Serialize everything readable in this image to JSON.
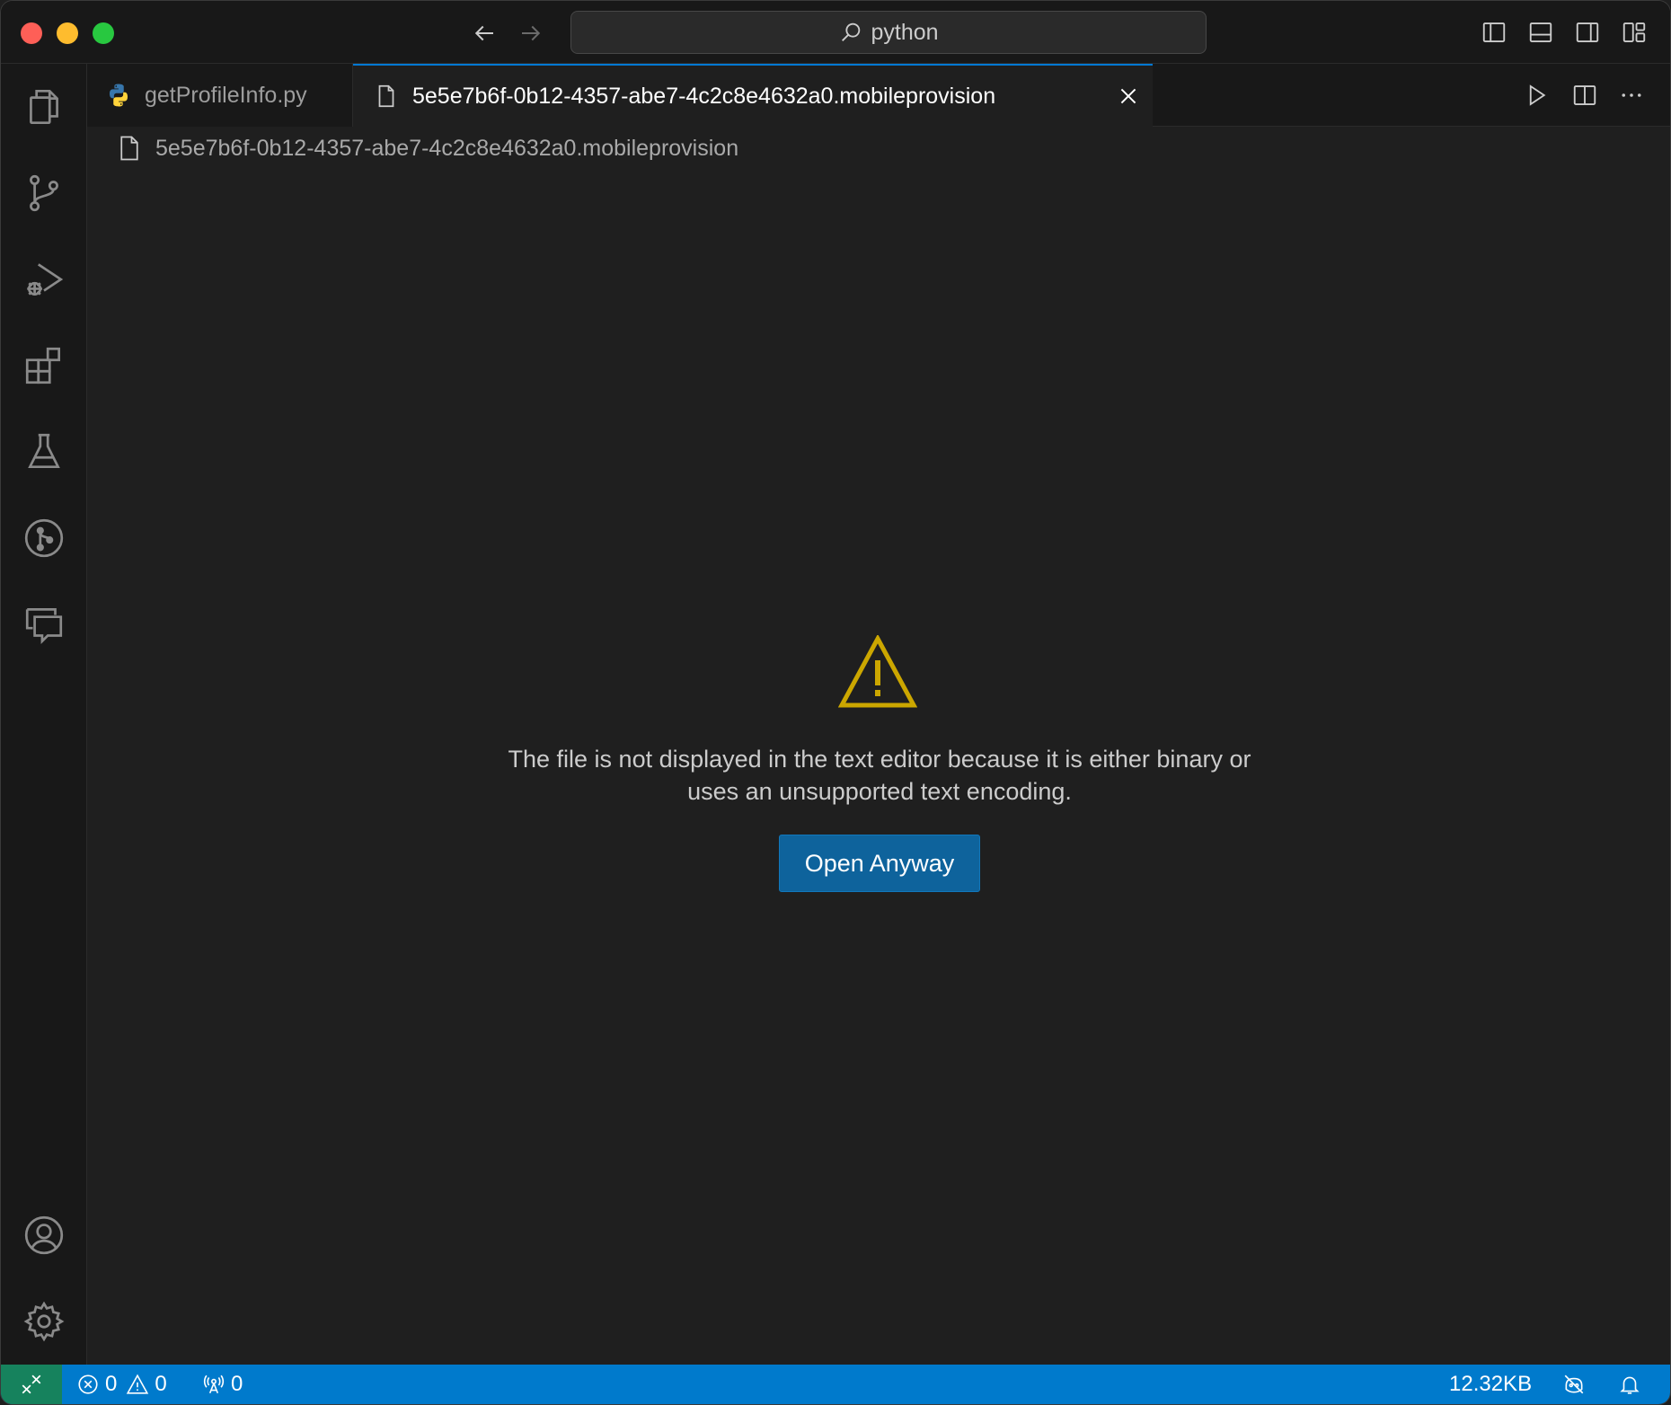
{
  "titlebar": {
    "command_center": "python",
    "icons": [
      "back-arrow-icon",
      "forward-arrow-icon",
      "search-icon",
      "toggle-primary-sidebar-icon",
      "toggle-panel-icon",
      "toggle-secondary-sidebar-icon",
      "customize-layout-icon"
    ]
  },
  "activitybar": {
    "items": [
      "explorer-icon",
      "source-control-icon",
      "run-debug-icon",
      "extensions-icon",
      "testing-icon",
      "git-graph-icon",
      "comments-icon"
    ],
    "bottom": [
      "accounts-icon",
      "manage-gear-icon"
    ]
  },
  "tabs": [
    {
      "label": "getProfileInfo.py",
      "icon": "python-file-icon",
      "active": false
    },
    {
      "label": "5e5e7b6f-0b12-4357-abe7-4c2c8e4632a0.mobileprovision",
      "icon": "file-icon",
      "active": true
    }
  ],
  "breadcrumb": {
    "file": "5e5e7b6f-0b12-4357-abe7-4c2c8e4632a0.mobileprovision"
  },
  "editor": {
    "message_line1": "The file is not displayed in the text editor because it is either binary or",
    "message_line2": "uses an unsupported text encoding.",
    "button": "Open Anyway"
  },
  "statusbar": {
    "errors": "0",
    "warnings": "0",
    "ports": "0",
    "file_size": "12.32KB"
  },
  "colors": {
    "accent": "#007acc",
    "button": "#0e639c",
    "warning": "#cca700",
    "remote": "#16825d"
  }
}
